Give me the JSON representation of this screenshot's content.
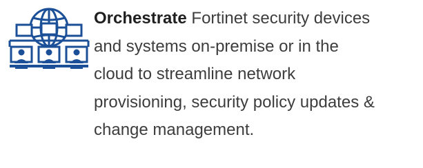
{
  "feature": {
    "icon": "globe-network-monitors-users-icon",
    "icon_color": "#1b4f97",
    "headline": "Orchestrate",
    "lines": [
      " Fortinet security devices",
      "and systems on-premise or in the",
      "cloud to streamline network",
      "provisioning, security policy updates &",
      "change management."
    ]
  }
}
